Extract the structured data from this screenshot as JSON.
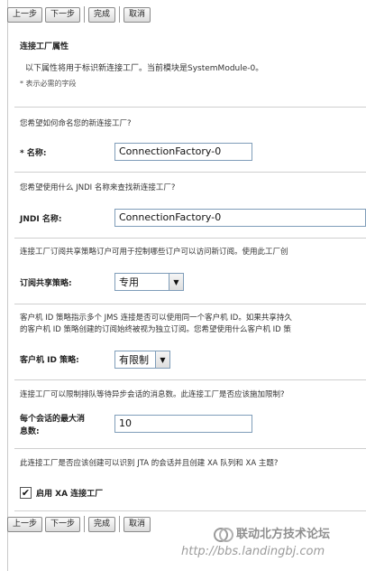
{
  "toolbar": {
    "prev_label": "上一步",
    "next_label": "下一步",
    "finish_label": "完成",
    "cancel_label": "取消"
  },
  "section": {
    "title": "连接工厂属性",
    "description": "以下属性将用于标识新连接工厂。当前模块是SystemModule-0。",
    "required_note": "* 表示必需的字段"
  },
  "fields": {
    "name": {
      "question": "您希望如何命名您的新连接工厂?",
      "label": "* 名称:",
      "value": "ConnectionFactory-0"
    },
    "jndi": {
      "question": "您希望使用什么 JNDI 名称来查找新连接工厂?",
      "label": "JNDI 名称:",
      "value": "ConnectionFactory-0"
    },
    "subscription": {
      "question": "连接工厂订阅共享策略订户可用于控制哪些订户可以访问新订阅。使用此工厂创",
      "label": "订阅共享策略:",
      "value": "专用"
    },
    "client_id": {
      "question_line1": "客户机 ID 策略指示多个 JMS 连接是否可以使用同一个客户机 ID。如果共享持久",
      "question_line2": "的客户机 ID 策略创建的订阅始终被视为独立订阅。您希望使用什么客户机 ID 策",
      "label": "客户机 ID 策略:",
      "value": "有限制"
    },
    "max_messages": {
      "question": "连接工厂可以限制排队等待异步会话的消息数。此连接工厂是否应该施加限制?",
      "label_line1": "每个会话的最大消",
      "label_line2": "息数:",
      "value": "10"
    },
    "xa": {
      "question": "此连接工厂是否应该创建可以识别 JTA 的会话并且创建 XA 队列和 XA 主题?",
      "label": "启用 XA 连接工厂",
      "checked": true
    }
  },
  "watermark": {
    "text1": "联动北方技术论坛",
    "text2": "http://bbs.landingbj.com"
  }
}
